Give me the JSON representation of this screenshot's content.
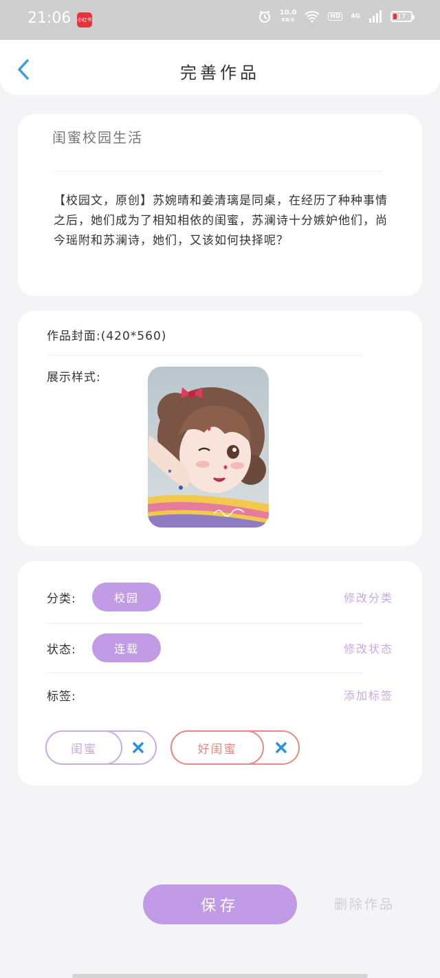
{
  "status_bar": {
    "time": "21:06",
    "app_badge": "小红书",
    "net_speed": "10.0",
    "net_speed_unit": "KB/S",
    "hd": "HD",
    "network": "4G",
    "battery": "17",
    "battery_color": "#e8323c"
  },
  "nav": {
    "back_icon": "chevron-left-icon",
    "title": "完善作品"
  },
  "work": {
    "title": "闺蜜校园生活",
    "description": "【校园文，原创】苏婉晴和姜清璃是同桌，在经历了种种事情之后，她们成为了相知相依的闺蜜，苏澜诗十分嫉妒他们，尚今瑶附和苏澜诗，她们，又该如何抉择呢？"
  },
  "cover": {
    "label": "作品封面:(420*560)",
    "style_label": "展示样式:"
  },
  "meta": {
    "category_label": "分类:",
    "category_value": "校园",
    "category_action": "修改分类",
    "status_label": "状态:",
    "status_value": "连载",
    "status_action": "修改状态",
    "tags_label": "标签:",
    "tags_action": "添加标签",
    "tags": [
      {
        "label": "闺蜜",
        "color": "#c9a9e6",
        "remove_icon": "close-icon"
      },
      {
        "label": "好闺蜜",
        "color": "#e58a80",
        "remove_icon": "close-icon"
      }
    ]
  },
  "actions": {
    "save": "保存",
    "delete": "删除作品"
  },
  "colors": {
    "accent": "#c29be6",
    "link": "#c9a9e6",
    "back_arrow": "#3a9be0",
    "remove_x": "#2b8fe0"
  }
}
